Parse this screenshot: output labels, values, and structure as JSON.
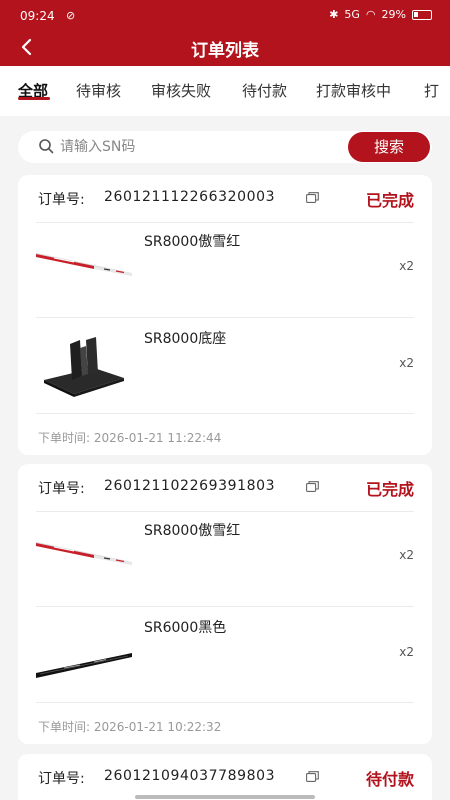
{
  "status_bar": {
    "time": "09:24",
    "notification": "⊘",
    "signal_text": "5G",
    "battery": "29%"
  },
  "header": {
    "title": "订单列表"
  },
  "tabs": [
    {
      "label": "全部",
      "active": true
    },
    {
      "label": "待审核",
      "active": false
    },
    {
      "label": "审核失败",
      "active": false
    },
    {
      "label": "待付款",
      "active": false
    },
    {
      "label": "打款审核中",
      "active": false
    },
    {
      "label": "打",
      "active": false
    }
  ],
  "search": {
    "placeholder": "请输入SN码",
    "button_label": "搜索"
  },
  "orders": [
    {
      "label": "订单号:",
      "number": "260121112266320003",
      "status": "已完成",
      "items": [
        {
          "name": "SR8000傲雪红",
          "qty": "x2",
          "thumb": "red-shaft"
        },
        {
          "name": "SR8000底座",
          "qty": "x2",
          "thumb": "black-stand"
        }
      ],
      "time_label": "下单时间:",
      "time": "2026-01-21 11:22:44"
    },
    {
      "label": "订单号:",
      "number": "260121102269391803",
      "status": "已完成",
      "items": [
        {
          "name": "SR8000傲雪红",
          "qty": "x2",
          "thumb": "red-shaft"
        },
        {
          "name": "SR6000黑色",
          "qty": "x2",
          "thumb": "black-shaft"
        }
      ],
      "time_label": "下单时间:",
      "time": "2026-01-21 10:22:32"
    },
    {
      "label": "订单号:",
      "number": "260121094037789803",
      "status": "待付款"
    }
  ],
  "colors": {
    "brand": "#b3131c",
    "background": "#f4f4f4"
  }
}
